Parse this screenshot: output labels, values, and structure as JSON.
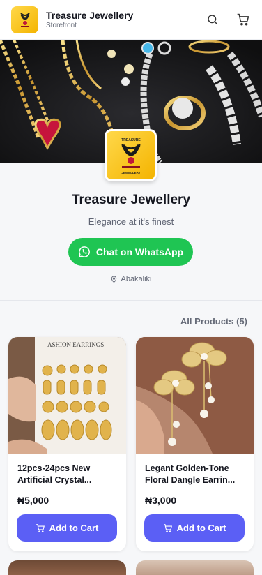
{
  "header": {
    "brand_name": "Treasure Jewellery",
    "brand_sub": "Storefront",
    "icons": [
      "search-icon",
      "cart-icon"
    ]
  },
  "store": {
    "title": "Treasure Jewellery",
    "tagline": "Elegance at it's finest",
    "whatsapp_label": "Chat on WhatsApp",
    "location": "Abakaliki",
    "logo_text_top": "TREASURE",
    "logo_text_bottom": "JEWELLERY"
  },
  "products_header": {
    "label": "All Products (5)"
  },
  "products": [
    {
      "title": "12pcs-24pcs New Artificial Crystal...",
      "price": "₦5,000",
      "add_label": "Add to Cart",
      "image_caption": "ASHION EARRINGS"
    },
    {
      "title": "Legant Golden-Tone Floral Dangle Earrin...",
      "price": "₦3,000",
      "add_label": "Add to Cart"
    }
  ],
  "colors": {
    "accent": "#5b5ff5",
    "whatsapp": "#1fc553",
    "logo_gold": "#f4b400"
  }
}
